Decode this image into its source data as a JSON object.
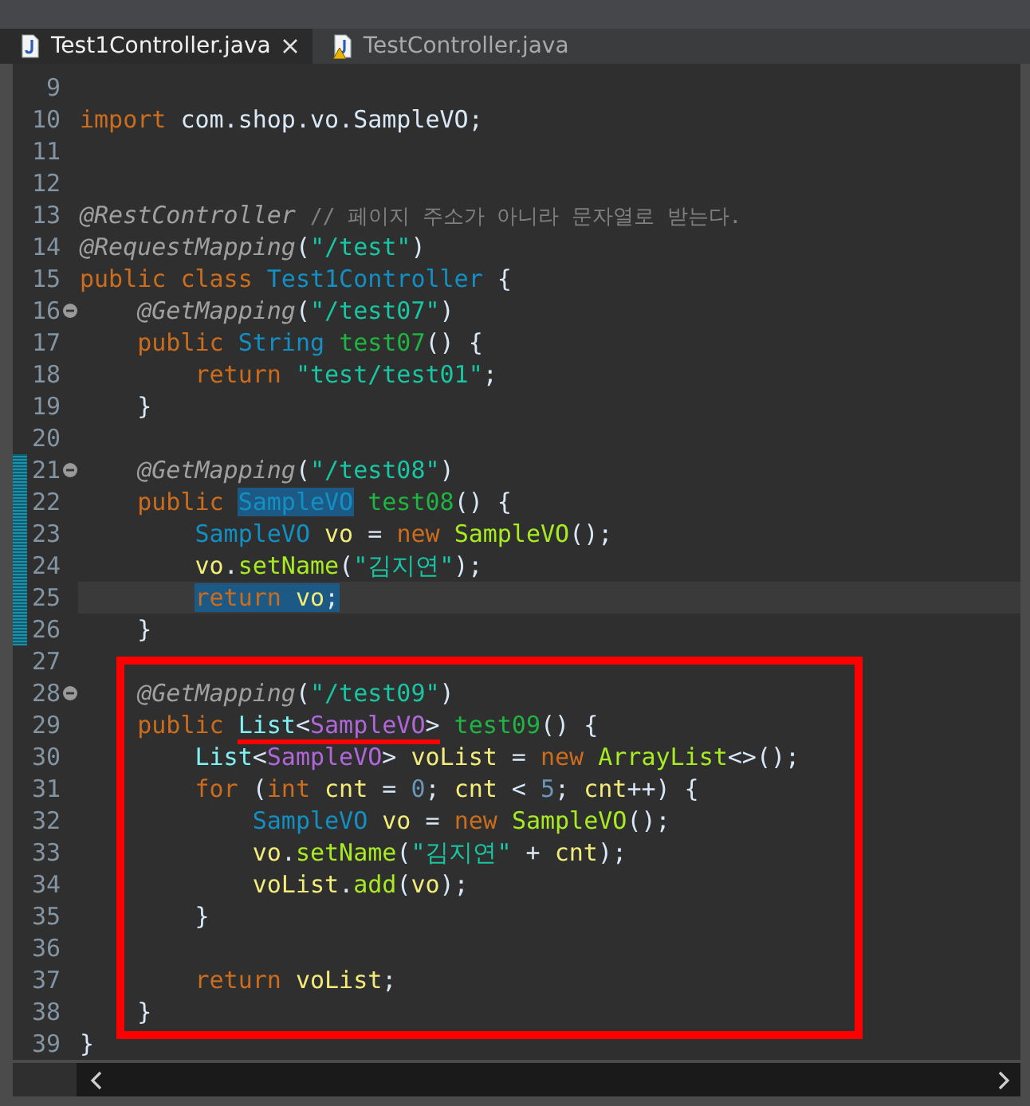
{
  "tabs": [
    {
      "label": "Test1Controller.java",
      "selected": true,
      "closable": true,
      "warning": false
    },
    {
      "label": "TestController.java",
      "selected": false,
      "closable": false,
      "warning": true
    }
  ],
  "editor": {
    "sections": [
      {
        "kind": "plain",
        "lines": [
          {
            "number": "9",
            "fold": false,
            "current": false
          },
          {
            "number": "10",
            "fold": false,
            "current": false,
            "tokens": [
              {
                "text": "import ",
                "kind": "kw"
              },
              {
                "text": "com.shop.vo.SampleVO;",
                "kind": "plain"
              }
            ]
          },
          {
            "number": "11",
            "fold": false,
            "current": false
          },
          {
            "number": "12",
            "fold": false,
            "current": false
          },
          {
            "number": "13",
            "fold": false,
            "current": false,
            "tokens": [
              {
                "text": "@RestController ",
                "kind": "ann"
              },
              {
                "text": "// 페이지 주소가 아니라 문자열로 받는다.",
                "kind": "comment"
              }
            ]
          },
          {
            "number": "14",
            "fold": false,
            "current": false,
            "tokens": [
              {
                "text": "@RequestMapping",
                "kind": "ann"
              },
              {
                "text": "(",
                "kind": "plain"
              },
              {
                "text": "\"/test\"",
                "kind": "str"
              },
              {
                "text": ")",
                "kind": "plain"
              }
            ]
          },
          {
            "number": "15",
            "fold": false,
            "current": false,
            "tokens": [
              {
                "text": "public class ",
                "kind": "kw"
              },
              {
                "text": "Test1Controller",
                "kind": "type"
              },
              {
                "text": " {",
                "kind": "plain"
              }
            ]
          },
          {
            "number": "16",
            "fold": true,
            "current": false,
            "tokens": [
              {
                "text": "    @GetMapping",
                "kind": "ann"
              },
              {
                "text": "(",
                "kind": "plain"
              },
              {
                "text": "\"/test07\"",
                "kind": "str"
              },
              {
                "text": ")",
                "kind": "plain"
              }
            ]
          },
          {
            "number": "17",
            "fold": false,
            "current": false,
            "tokens": [
              {
                "text": "    public ",
                "kind": "kw"
              },
              {
                "text": "String ",
                "kind": "type"
              },
              {
                "text": "test07",
                "kind": "method"
              },
              {
                "text": "() {",
                "kind": "plain"
              }
            ]
          },
          {
            "number": "18",
            "fold": false,
            "current": false,
            "tokens": [
              {
                "text": "        return ",
                "kind": "kw"
              },
              {
                "text": "\"test/test01\"",
                "kind": "str"
              },
              {
                "text": ";",
                "kind": "plain"
              }
            ]
          },
          {
            "number": "19",
            "fold": false,
            "current": false,
            "tokens": [
              {
                "text": "    }",
                "kind": "plain"
              }
            ]
          },
          {
            "number": "20",
            "fold": false,
            "current": false
          }
        ]
      },
      {
        "kind": "changed",
        "lines": [
          {
            "number": "21",
            "fold": true,
            "current": false,
            "tokens": [
              {
                "text": "    @GetMapping",
                "kind": "ann"
              },
              {
                "text": "(",
                "kind": "plain"
              },
              {
                "text": "\"/test08\"",
                "kind": "str"
              },
              {
                "text": ")",
                "kind": "plain"
              }
            ]
          },
          {
            "number": "22",
            "fold": false,
            "current": false,
            "tokens": [
              {
                "text": "    public ",
                "kind": "kw"
              },
              {
                "kind": "selection",
                "tokens": [
                  {
                    "text": "SampleVO",
                    "kind": "type"
                  }
                ]
              },
              {
                "text": " test08",
                "kind": "method"
              },
              {
                "text": "() {",
                "kind": "plain"
              }
            ]
          },
          {
            "number": "23",
            "fold": false,
            "current": false,
            "tokens": [
              {
                "text": "        SampleVO ",
                "kind": "type"
              },
              {
                "text": "vo",
                "kind": "var"
              },
              {
                "text": " = ",
                "kind": "plain"
              },
              {
                "text": "new ",
                "kind": "kw"
              },
              {
                "text": "SampleVO",
                "kind": "call"
              },
              {
                "text": "();",
                "kind": "plain"
              }
            ]
          },
          {
            "number": "24",
            "fold": false,
            "current": false,
            "tokens": [
              {
                "text": "        vo",
                "kind": "var"
              },
              {
                "text": ".",
                "kind": "plain"
              },
              {
                "text": "setName",
                "kind": "call"
              },
              {
                "text": "(",
                "kind": "plain"
              },
              {
                "text": "\"김지연\"",
                "kind": "str"
              },
              {
                "text": ");",
                "kind": "plain"
              }
            ]
          },
          {
            "number": "25",
            "fold": false,
            "current": true,
            "tokens": [
              {
                "kind": "indentedselection",
                "tokens": [
                  {
                    "text": "return ",
                    "kind": "kw"
                  },
                  {
                    "text": "vo",
                    "kind": "var"
                  },
                  {
                    "text": ";",
                    "kind": "plain"
                  }
                ]
              }
            ]
          },
          {
            "number": "26",
            "fold": false,
            "current": false,
            "tokens": [
              {
                "text": "    }",
                "kind": "plain"
              }
            ]
          }
        ]
      },
      {
        "kind": "plain",
        "lines": [
          {
            "number": "27",
            "fold": false,
            "current": false
          }
        ]
      },
      {
        "kind": "boxed",
        "lines": [
          {
            "number": "28",
            "fold": true,
            "current": false,
            "tokens": [
              {
                "text": "    @GetMapping",
                "kind": "ann"
              },
              {
                "text": "(",
                "kind": "plain"
              },
              {
                "text": "\"/test09\"",
                "kind": "str"
              },
              {
                "text": ")",
                "kind": "plain"
              }
            ]
          },
          {
            "number": "29",
            "fold": false,
            "current": false,
            "tokens": [
              {
                "text": "    public ",
                "kind": "kw"
              },
              {
                "kind": "underline",
                "tokens": [
                  {
                    "text": "List",
                    "kind": "iface"
                  },
                  {
                    "text": "<",
                    "kind": "plain"
                  },
                  {
                    "text": "SampleVO",
                    "kind": "generic"
                  },
                  {
                    "text": ">",
                    "kind": "plain"
                  }
                ]
              },
              {
                "text": " test09",
                "kind": "method"
              },
              {
                "text": "() {",
                "kind": "plain"
              }
            ]
          },
          {
            "number": "30",
            "fold": false,
            "current": false,
            "tokens": [
              {
                "text": "        List",
                "kind": "iface"
              },
              {
                "text": "<",
                "kind": "plain"
              },
              {
                "text": "SampleVO",
                "kind": "generic"
              },
              {
                "text": "> ",
                "kind": "plain"
              },
              {
                "text": "voList",
                "kind": "var"
              },
              {
                "text": " = ",
                "kind": "plain"
              },
              {
                "text": "new ",
                "kind": "kw"
              },
              {
                "text": "ArrayList",
                "kind": "call"
              },
              {
                "text": "<>();",
                "kind": "plain"
              }
            ]
          },
          {
            "number": "31",
            "fold": false,
            "current": false,
            "tokens": [
              {
                "text": "        for",
                "kind": "kw"
              },
              {
                "text": " (",
                "kind": "plain"
              },
              {
                "text": "int ",
                "kind": "kw"
              },
              {
                "text": "cnt",
                "kind": "var"
              },
              {
                "text": " = ",
                "kind": "plain"
              },
              {
                "text": "0",
                "kind": "num"
              },
              {
                "text": "; ",
                "kind": "plain"
              },
              {
                "text": "cnt",
                "kind": "var"
              },
              {
                "text": " < ",
                "kind": "plain"
              },
              {
                "text": "5",
                "kind": "num"
              },
              {
                "text": "; ",
                "kind": "plain"
              },
              {
                "text": "cnt",
                "kind": "var"
              },
              {
                "text": "++) {",
                "kind": "plain"
              }
            ]
          },
          {
            "number": "32",
            "fold": false,
            "current": false,
            "tokens": [
              {
                "text": "            SampleVO ",
                "kind": "type"
              },
              {
                "text": "vo",
                "kind": "var"
              },
              {
                "text": " = ",
                "kind": "plain"
              },
              {
                "text": "new ",
                "kind": "kw"
              },
              {
                "text": "SampleVO",
                "kind": "call"
              },
              {
                "text": "();",
                "kind": "plain"
              }
            ]
          },
          {
            "number": "33",
            "fold": false,
            "current": false,
            "tokens": [
              {
                "text": "            vo",
                "kind": "var"
              },
              {
                "text": ".",
                "kind": "plain"
              },
              {
                "text": "setName",
                "kind": "call"
              },
              {
                "text": "(",
                "kind": "plain"
              },
              {
                "text": "\"김지연\"",
                "kind": "str"
              },
              {
                "text": " + ",
                "kind": "plain"
              },
              {
                "text": "cnt",
                "kind": "var"
              },
              {
                "text": ");",
                "kind": "plain"
              }
            ]
          },
          {
            "number": "34",
            "fold": false,
            "current": false,
            "tokens": [
              {
                "text": "            voList",
                "kind": "var"
              },
              {
                "text": ".",
                "kind": "plain"
              },
              {
                "text": "add",
                "kind": "call"
              },
              {
                "text": "(",
                "kind": "plain"
              },
              {
                "text": "vo",
                "kind": "var"
              },
              {
                "text": ");",
                "kind": "plain"
              }
            ]
          },
          {
            "number": "35",
            "fold": false,
            "current": false,
            "tokens": [
              {
                "text": "        }",
                "kind": "plain"
              }
            ]
          },
          {
            "number": "36",
            "fold": false,
            "current": false
          },
          {
            "number": "37",
            "fold": false,
            "current": false,
            "tokens": [
              {
                "text": "        return ",
                "kind": "kw"
              },
              {
                "text": "voList",
                "kind": "var"
              },
              {
                "text": ";",
                "kind": "plain"
              }
            ]
          },
          {
            "number": "38",
            "fold": false,
            "current": false,
            "tokens": [
              {
                "text": "    }",
                "kind": "plain"
              }
            ]
          }
        ]
      },
      {
        "kind": "plain",
        "lines": [
          {
            "number": "39",
            "fold": false,
            "current": false,
            "tokens": [
              {
                "text": "}",
                "kind": "plain"
              }
            ]
          }
        ]
      }
    ]
  }
}
